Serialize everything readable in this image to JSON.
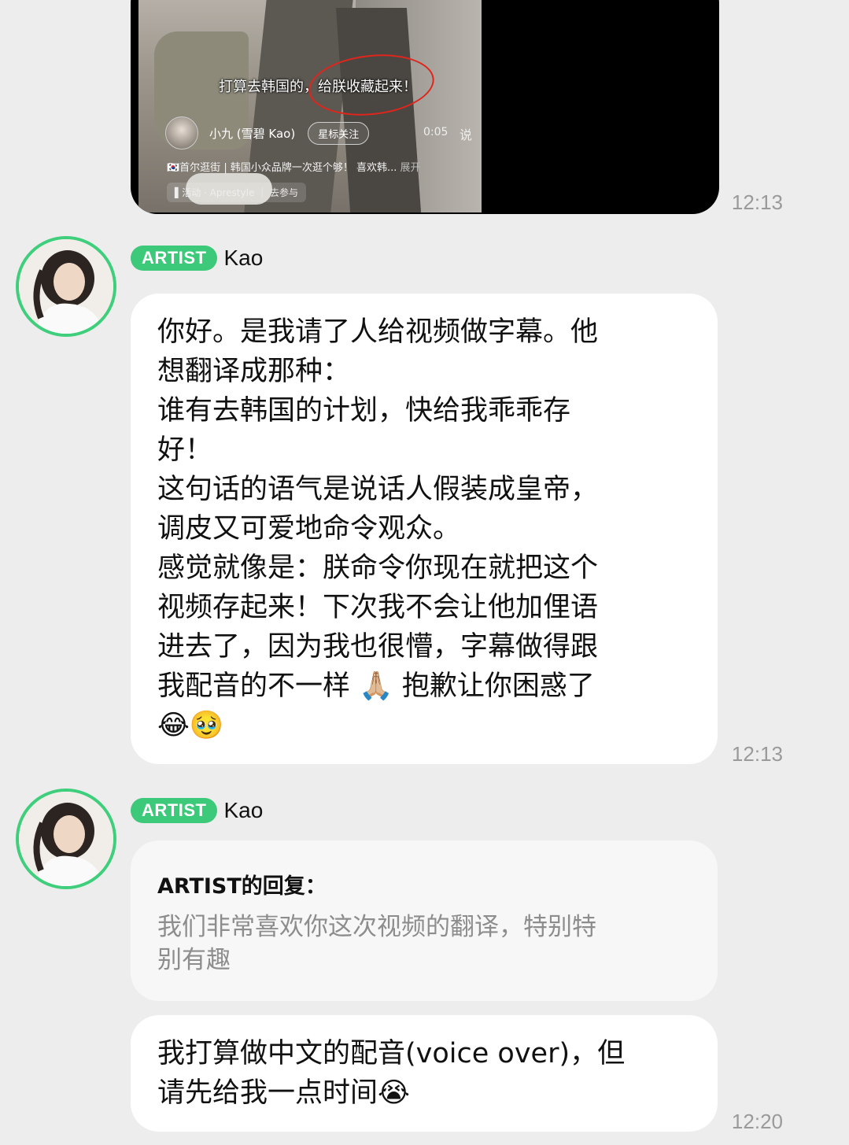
{
  "video": {
    "subtitle": "打算去韩国的，给朕收藏起来！",
    "author_name": "小九 (雪碧 Kao)",
    "follow_button": "星标关注",
    "duration": "0:05",
    "share_icon_label": "说",
    "description": "🇰🇷首尔逛街 | 韩国小众品牌一次逛个够！ 喜欢韩...",
    "expand_label": "展开",
    "activity_tag": "▌活动 · Aprestyle ｜ 去参与",
    "timestamp": "12:13"
  },
  "messages": [
    {
      "badge": "ARTIST",
      "sender": "Kao",
      "lines": [
        "你好。是我请了人给视频做字幕。他",
        "想翻译成那种：",
        "谁有去韩国的计划，快给我乖乖存",
        "好！",
        "这句话的语气是说话人假装成皇帝，",
        "调皮又可爱地命令观众。",
        "感觉就像是：朕命令你现在就把这个",
        "视频存起来！下次我不会让他加俚语",
        "进去了，因为我也很懵，字幕做得跟",
        "我配音的不一样 🙏🏼 抱歉让你困惑了",
        "😂🥹"
      ],
      "timestamp": "12:13"
    },
    {
      "badge": "ARTIST",
      "sender": "Kao",
      "quote_header": "ARTIST的回复：",
      "quote_lines": [
        "我们非常喜欢你这次视频的翻译，特别特",
        "别有趣"
      ],
      "reply_lines": [
        "我打算做中文的配音(voice over)，但",
        "请先给我一点时间😭"
      ],
      "timestamp": "12:20"
    }
  ],
  "colors": {
    "background": "#ededed",
    "badge": "#3cc97a",
    "avatar_ring": "#3fcf7c",
    "annotation_circle": "#e0251c"
  }
}
